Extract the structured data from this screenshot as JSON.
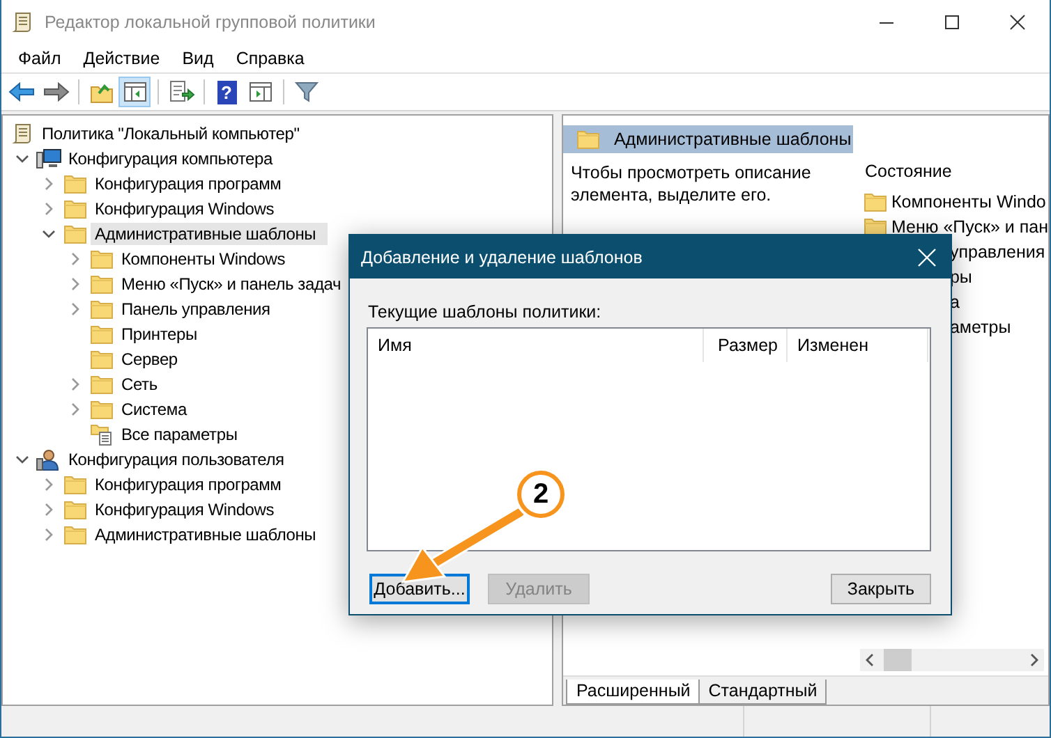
{
  "window": {
    "title": "Редактор локальной групповой политики",
    "controls": [
      {
        "kind": "minimize"
      },
      {
        "kind": "maximize"
      },
      {
        "kind": "close"
      }
    ]
  },
  "menu": [
    "Файл",
    "Действие",
    "Вид",
    "Справка"
  ],
  "toolbar": [
    {
      "kind": "back",
      "pressed": false
    },
    {
      "kind": "forward",
      "pressed": false
    },
    {
      "kind": "separator"
    },
    {
      "kind": "up",
      "pressed": false
    },
    {
      "kind": "pane",
      "pressed": true
    },
    {
      "kind": "separator"
    },
    {
      "kind": "export",
      "pressed": false
    },
    {
      "kind": "separator"
    },
    {
      "kind": "help",
      "pressed": false,
      "glyph": "?"
    },
    {
      "kind": "view",
      "pressed": false
    },
    {
      "kind": "separator"
    },
    {
      "kind": "filter",
      "pressed": false
    }
  ],
  "tree": {
    "label": "Политика \"Локальный компьютер\"",
    "kind": "scroll",
    "children": [
      {
        "label": "Конфигурация компьютера",
        "kind": "computer",
        "expandable": true,
        "expanded": true,
        "selected": false,
        "children": [
          {
            "label": "Конфигурация программ",
            "kind": "folder",
            "expandable": true,
            "expanded": false,
            "selected": false
          },
          {
            "label": "Конфигурация Windows",
            "kind": "folder",
            "expandable": true,
            "expanded": false,
            "selected": false
          },
          {
            "label": "Административные шаблоны",
            "kind": "folder",
            "expandable": true,
            "expanded": true,
            "selected": true,
            "children": [
              {
                "label": "Компоненты Windows",
                "kind": "folder",
                "expandable": true,
                "expanded": false,
                "selected": false
              },
              {
                "label": "Меню «Пуск» и панель задач",
                "kind": "folder",
                "expandable": true,
                "expanded": false,
                "selected": false
              },
              {
                "label": "Панель управления",
                "kind": "folder",
                "expandable": true,
                "expanded": false,
                "selected": false
              },
              {
                "label": "Принтеры",
                "kind": "folder",
                "expandable": false,
                "selected": false
              },
              {
                "label": "Сервер",
                "kind": "folder",
                "expandable": false,
                "selected": false
              },
              {
                "label": "Сеть",
                "kind": "folder",
                "expandable": true,
                "expanded": false,
                "selected": false
              },
              {
                "label": "Система",
                "kind": "folder",
                "expandable": true,
                "expanded": false,
                "selected": false
              },
              {
                "label": "Все параметры",
                "kind": "settings",
                "expandable": false,
                "selected": false
              }
            ]
          }
        ]
      },
      {
        "label": "Конфигурация пользователя",
        "kind": "user",
        "expandable": true,
        "expanded": true,
        "selected": false,
        "children": [
          {
            "label": "Конфигурация программ",
            "kind": "folder",
            "expandable": true,
            "expanded": false,
            "selected": false
          },
          {
            "label": "Конфигурация Windows",
            "kind": "folder",
            "expandable": true,
            "expanded": false,
            "selected": false
          },
          {
            "label": "Административные шаблоны",
            "kind": "folder",
            "expandable": true,
            "expanded": false,
            "selected": false
          }
        ]
      }
    ]
  },
  "details": {
    "header": "Административные шаблоны",
    "description": "Чтобы просмотреть описание элемента, выделите его.",
    "column": "Состояние",
    "items": [
      "Компоненты Windo",
      "Меню «Пуск» и пан"
    ],
    "items_behind_dialog": [
      "управления",
      "ры",
      "а",
      "аметры"
    ],
    "tabs": [
      {
        "label": "Расширенный",
        "selected": true
      },
      {
        "label": "Стандартный",
        "selected": false
      }
    ]
  },
  "dialog": {
    "title": "Добавление и удаление шаблонов",
    "list_label": "Текущие шаблоны политики:",
    "columns": [
      "Имя",
      "Размер",
      "Изменен"
    ],
    "buttons": [
      {
        "label": "Добавить...",
        "focused": true,
        "disabled": false
      },
      {
        "label": "Удалить",
        "focused": false,
        "disabled": true
      },
      {
        "label": "Закрыть",
        "focused": false,
        "disabled": false
      }
    ]
  },
  "callout": {
    "number": "2"
  }
}
